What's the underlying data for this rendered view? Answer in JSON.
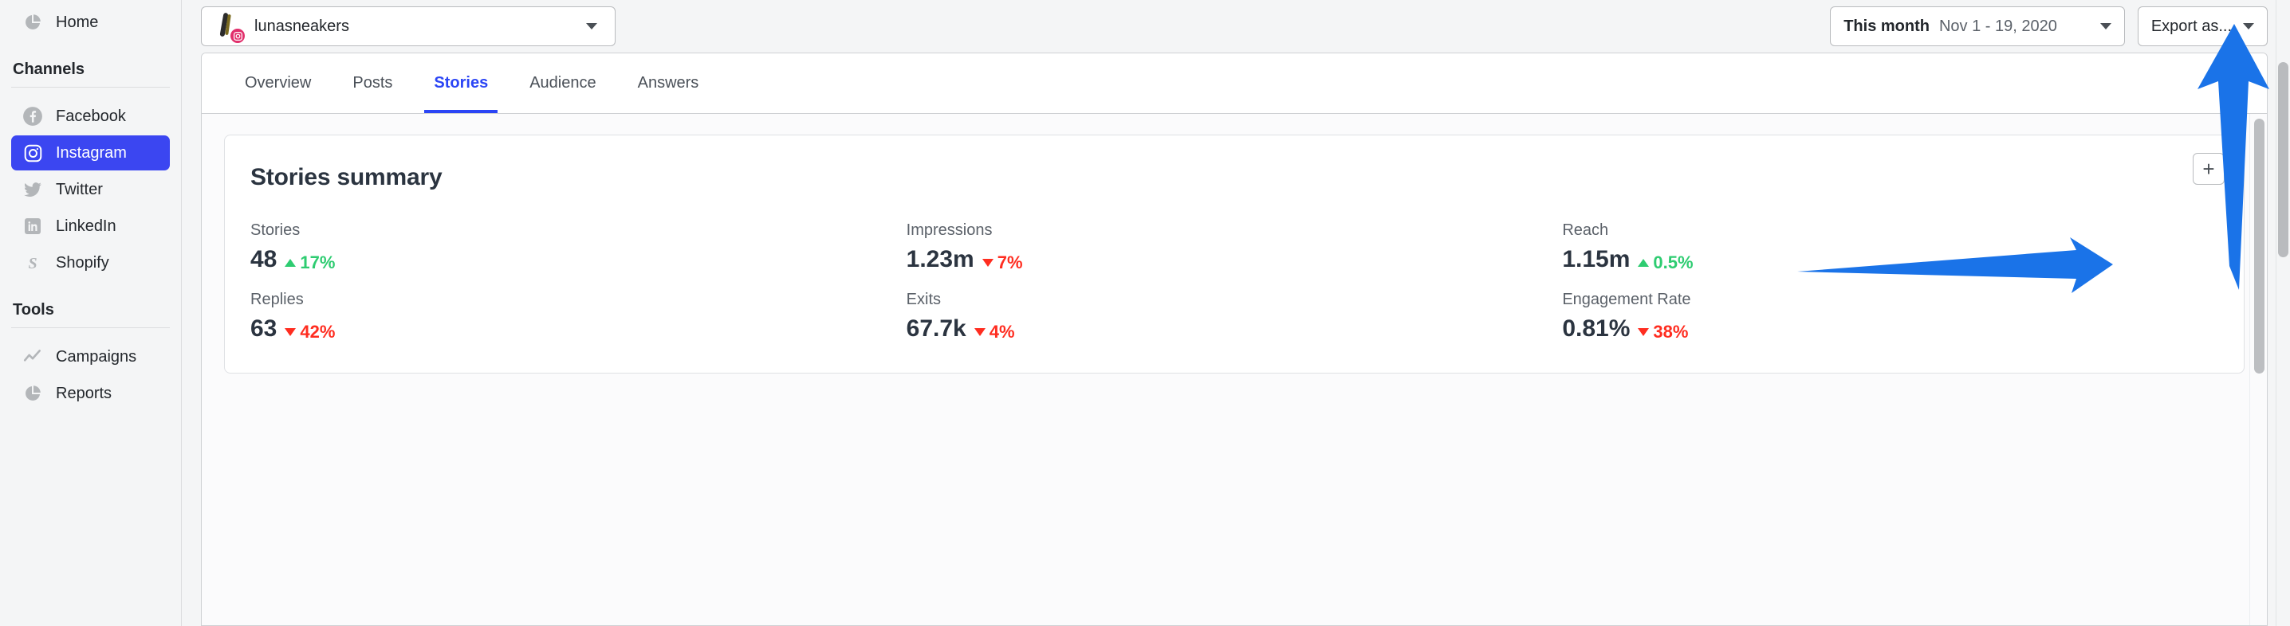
{
  "sidebar": {
    "top_items": [
      {
        "label": "Home",
        "icon": "pie-chart-icon"
      }
    ],
    "channels_title": "Channels",
    "channels": [
      {
        "label": "Facebook",
        "icon": "facebook-icon",
        "active": false
      },
      {
        "label": "Instagram",
        "icon": "instagram-icon",
        "active": true
      },
      {
        "label": "Twitter",
        "icon": "twitter-icon",
        "active": false
      },
      {
        "label": "LinkedIn",
        "icon": "linkedin-icon",
        "active": false
      },
      {
        "label": "Shopify",
        "icon": "shopify-icon",
        "active": false
      }
    ],
    "tools_title": "Tools",
    "tools": [
      {
        "label": "Campaigns",
        "icon": "trend-line-icon"
      },
      {
        "label": "Reports",
        "icon": "pie-chart-icon"
      }
    ]
  },
  "topbar": {
    "account": {
      "name": "lunasneakers",
      "badge_icon": "instagram-icon",
      "caret_icon": "chevron-down-icon"
    },
    "date_range": {
      "label": "This month",
      "value": "Nov 1 - 19, 2020",
      "caret_icon": "chevron-down-icon"
    },
    "export": {
      "label": "Export as...",
      "caret_icon": "chevron-down-icon"
    }
  },
  "tabs": [
    {
      "label": "Overview",
      "active": false
    },
    {
      "label": "Posts",
      "active": false
    },
    {
      "label": "Stories",
      "active": true
    },
    {
      "label": "Audience",
      "active": false
    },
    {
      "label": "Answers",
      "active": false
    }
  ],
  "card": {
    "title": "Stories summary",
    "add_button_label": "+",
    "metrics": [
      {
        "label": "Stories",
        "value": "48",
        "delta": "17%",
        "direction": "up"
      },
      {
        "label": "Impressions",
        "value": "1.23m",
        "delta": "7%",
        "direction": "down"
      },
      {
        "label": "Reach",
        "value": "1.15m",
        "delta": "0.5%",
        "direction": "up"
      },
      {
        "label": "Replies",
        "value": "63",
        "delta": "42%",
        "direction": "down"
      },
      {
        "label": "Exits",
        "value": "67.7k",
        "delta": "4%",
        "direction": "down"
      },
      {
        "label": "Engagement Rate",
        "value": "0.81%",
        "delta": "38%",
        "direction": "down"
      }
    ]
  },
  "colors": {
    "accent": "#2b45f5",
    "sidebar_active": "#3b46f1",
    "positive": "#2ecc71",
    "negative": "#ff2d20",
    "annotation": "#1a73e8"
  },
  "annotations": [
    {
      "name": "arrow-pointing-to-add-button",
      "direction": "right"
    },
    {
      "name": "arrow-pointing-to-export-button",
      "direction": "up"
    }
  ]
}
